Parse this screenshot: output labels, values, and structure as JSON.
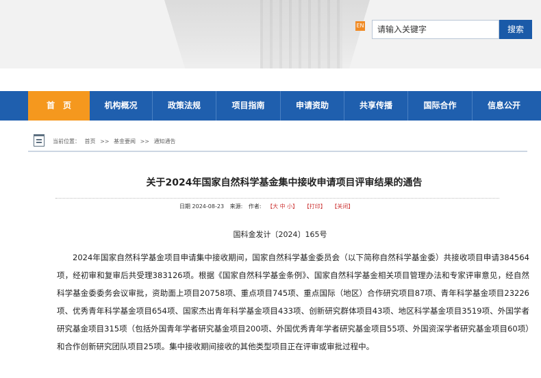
{
  "header": {
    "lang_icon": "EN",
    "search_placeholder": "请输入关键字",
    "search_button": "搜索"
  },
  "nav": {
    "items": [
      {
        "label": "首　页",
        "active": true
      },
      {
        "label": "机构概况"
      },
      {
        "label": "政策法规"
      },
      {
        "label": "项目指南"
      },
      {
        "label": "申请资助"
      },
      {
        "label": "共享传播"
      },
      {
        "label": "国际合作"
      },
      {
        "label": "信息公开"
      }
    ]
  },
  "breadcrumb": {
    "prefix": "当前位置：",
    "items": [
      "首页",
      ">>",
      "基金要闻",
      ">>",
      "通知通告"
    ]
  },
  "article": {
    "title": "关于2024年国家自然科学基金集中接收申请项目评审结果的通告",
    "date": "日期 2024-08-23",
    "source": "来源:",
    "author": "作者:",
    "font_size": "【大 中 小】",
    "print": "【打印】",
    "close": "【关闭】",
    "doc_number": "国科金发计〔2024〕165号",
    "body": "2024年国家自然科学基金项目申请集中接收期间，国家自然科学基金委员会（以下简称自然科学基金委）共接收项目申请384564项，经初审和复审后共受理383126项。根据《国家自然科学基金条例》、国家自然科学基金相关项目管理办法和专家评审意见，经自然科学基金委委务会议审批，资助面上项目20758项、重点项目745项、重点国际（地区）合作研究项目87项、青年科学基金项目23226项、优秀青年科学基金项目654项、国家杰出青年科学基金项目433项、创新研究群体项目43项、地区科学基金项目3519项、外国学者研究基金项目315项（包括外国青年学者研究基金项目200项、外国优秀青年学者研究基金项目55项、外国资深学者研究基金项目60项）和合作创新研究团队项目25项。集中接收期间接收的其他类型项目正在评审或审批过程中。"
  },
  "colors": {
    "nav_bg": "#1f5fae",
    "nav_active": "#f5981e",
    "search_button": "#1a5aa8"
  }
}
